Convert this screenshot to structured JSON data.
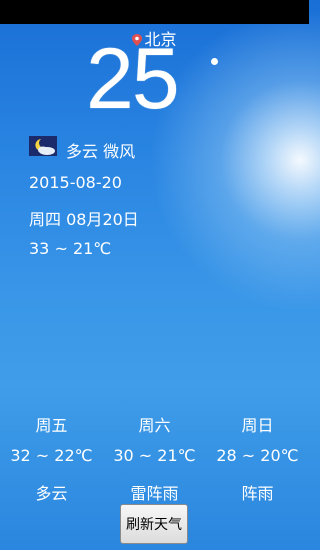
{
  "city": "北京",
  "current": {
    "temperature": "25",
    "condition": "多云 微风",
    "date": "2015-08-20",
    "weekday_date": "周四 08月20日",
    "range": "33 ~ 21℃",
    "icon": "moon-cloud-icon"
  },
  "forecast": [
    {
      "day": "周五",
      "range": "32 ~ 22℃",
      "condition": "多云"
    },
    {
      "day": "周六",
      "range": "30 ~ 21℃",
      "condition": "雷阵雨"
    },
    {
      "day": "周日",
      "range": "28 ~ 20℃",
      "condition": "阵雨"
    }
  ],
  "refresh_label": "刷新天气",
  "colors": {
    "sky_top": "#1a6fd6",
    "sky_bottom": "#2a86de",
    "pin": "#e05050"
  }
}
